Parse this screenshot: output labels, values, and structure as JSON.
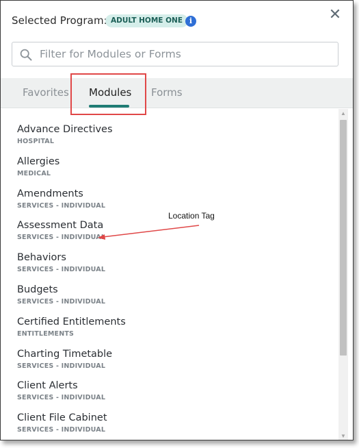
{
  "header": {
    "selected_program_label": "Selected Program:",
    "program_badge": "ADULT HOME ONE",
    "info_icon": "i",
    "close_icon": "✕"
  },
  "search": {
    "placeholder": "Filter for Modules or Forms",
    "value": ""
  },
  "tabs": [
    {
      "label": "Favorites",
      "active": false
    },
    {
      "label": "Modules",
      "active": true
    },
    {
      "label": "Forms",
      "active": false
    }
  ],
  "modules": [
    {
      "title": "Advance Directives",
      "tag": "HOSPITAL"
    },
    {
      "title": "Allergies",
      "tag": "MEDICAL"
    },
    {
      "title": "Amendments",
      "tag": "SERVICES - INDIVIDUAL"
    },
    {
      "title": "Assessment Data",
      "tag": "SERVICES - INDIVIDUAL"
    },
    {
      "title": "Behaviors",
      "tag": "SERVICES - INDIVIDUAL"
    },
    {
      "title": "Budgets",
      "tag": "SERVICES - INDIVIDUAL"
    },
    {
      "title": "Certified Entitlements",
      "tag": "ENTITLEMENTS"
    },
    {
      "title": "Charting Timetable",
      "tag": "SERVICES - INDIVIDUAL"
    },
    {
      "title": "Client Alerts",
      "tag": "SERVICES - INDIVIDUAL"
    },
    {
      "title": "Client File Cabinet",
      "tag": "SERVICES - INDIVIDUAL"
    }
  ],
  "annotation": {
    "text": "Location Tag",
    "color": "#e04747"
  },
  "colors": {
    "accent": "#1f7c74",
    "badge_bg": "#d5eeea",
    "info_icon": "#2f6fd6",
    "highlight": "#e04747"
  }
}
